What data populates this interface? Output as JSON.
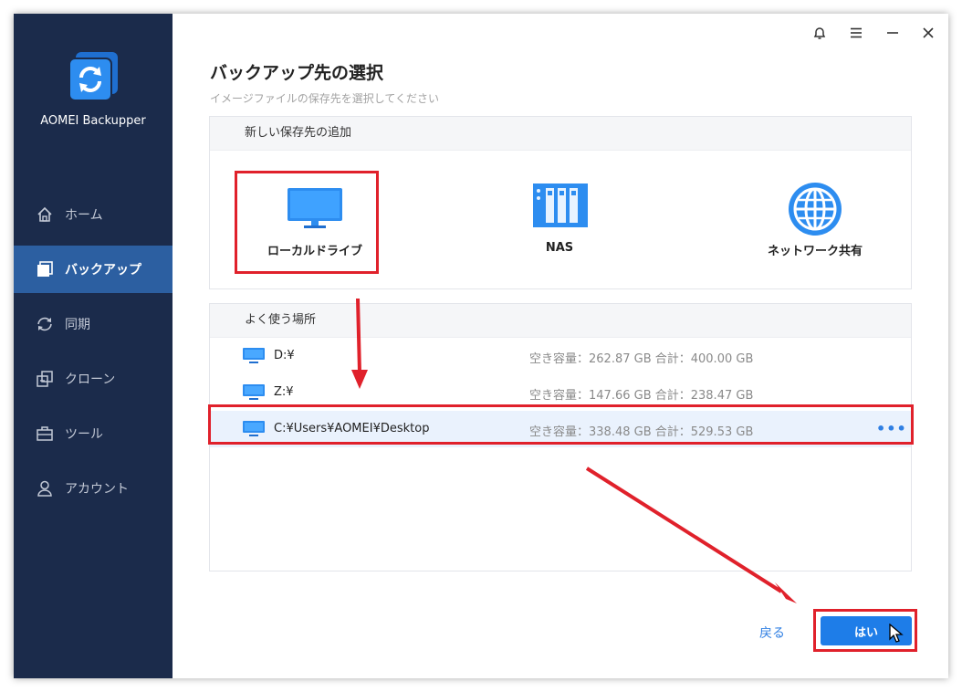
{
  "app": {
    "name": "AOMEI Backupper"
  },
  "sidebar": {
    "items": [
      {
        "label": "ホーム",
        "icon": "home-icon"
      },
      {
        "label": "バックアップ",
        "icon": "backup-icon",
        "active": true
      },
      {
        "label": "同期",
        "icon": "sync-icon"
      },
      {
        "label": "クローン",
        "icon": "clone-icon"
      },
      {
        "label": "ツール",
        "icon": "tools-icon"
      },
      {
        "label": "アカウント",
        "icon": "account-icon"
      }
    ]
  },
  "titlebar": {
    "icons": [
      "bell-icon",
      "menu-icon",
      "minimize-icon",
      "close-icon"
    ]
  },
  "page": {
    "title": "バックアップ先の選択",
    "subtitle": "イメージファイルの保存先を選択してください"
  },
  "add_destination": {
    "header": "新しい保存先の追加",
    "options": [
      {
        "label": "ローカルドライブ",
        "icon": "monitor-icon"
      },
      {
        "label": "NAS",
        "icon": "nas-icon"
      },
      {
        "label": "ネットワーク共有",
        "icon": "globe-icon"
      }
    ]
  },
  "frequent": {
    "header": "よく使う場所",
    "rows": [
      {
        "name": "D:¥",
        "space": "空き容量：262.87 GB 合計：400.00 GB"
      },
      {
        "name": "Z:¥",
        "space": "空き容量：147.66 GB 合計：238.47 GB"
      },
      {
        "name": "C:¥Users¥AOMEI¥Desktop",
        "space": "空き容量：338.48 GB 合計：529.53 GB",
        "selected": true,
        "more": "•••"
      }
    ]
  },
  "footer": {
    "back_label": "戻る",
    "ok_label": "はい"
  },
  "colors": {
    "sidebar": "#1b2b4b",
    "active": "#2c5fa1",
    "accent": "#1e7de8",
    "highlight": "#e0212b"
  }
}
